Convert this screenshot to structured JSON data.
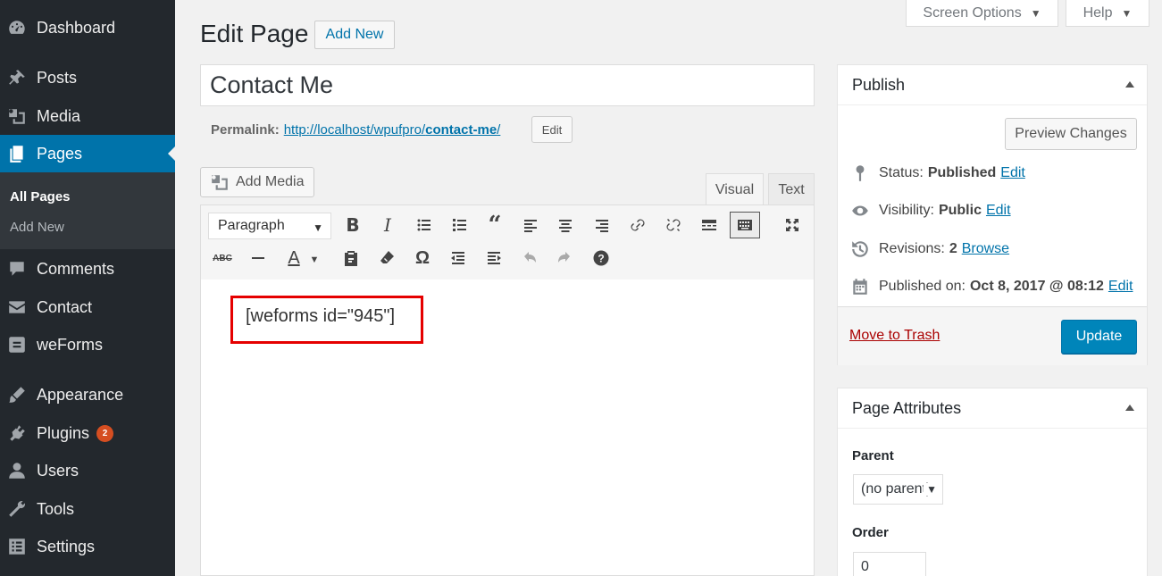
{
  "sidebar": {
    "items": [
      {
        "label": "Dashboard",
        "icon": "dashboard-icon"
      },
      {
        "label": "Posts",
        "icon": "pin-icon"
      },
      {
        "label": "Media",
        "icon": "media-icon"
      },
      {
        "label": "Pages",
        "icon": "pages-icon"
      },
      {
        "label": "Comments",
        "icon": "comments-icon"
      },
      {
        "label": "Contact",
        "icon": "envelope-icon"
      },
      {
        "label": "weForms",
        "icon": "weforms-icon"
      },
      {
        "label": "Appearance",
        "icon": "brush-icon"
      },
      {
        "label": "Plugins",
        "icon": "plugin-icon",
        "badge": "2"
      },
      {
        "label": "Users",
        "icon": "users-icon"
      },
      {
        "label": "Tools",
        "icon": "wrench-icon"
      },
      {
        "label": "Settings",
        "icon": "settings-icon"
      }
    ],
    "submenu": [
      "All Pages",
      "Add New"
    ]
  },
  "screen_meta": {
    "screen_options": "Screen Options",
    "help": "Help"
  },
  "heading": {
    "title": "Edit Page",
    "add_new": "Add New"
  },
  "post": {
    "title": "Contact Me",
    "permalink_label": "Permalink:",
    "permalink_base": "http://localhost/wpufpro/",
    "permalink_slug": "contact-me",
    "permalink_trailing": "/",
    "permalink_edit": "Edit"
  },
  "editor": {
    "add_media": "Add Media",
    "tab_visual": "Visual",
    "tab_text": "Text",
    "format": "Paragraph",
    "content": "[weforms id=\"945\"]",
    "highlight_color": "#e50000"
  },
  "publish": {
    "title": "Publish",
    "preview": "Preview Changes",
    "status_label": "Status:",
    "status_value": "Published",
    "visibility_label": "Visibility:",
    "visibility_value": "Public",
    "revisions_label": "Revisions:",
    "revisions_value": "2",
    "browse": "Browse",
    "published_label": "Published on:",
    "published_value": "Oct 8, 2017 @ 08:12",
    "edit": "Edit",
    "trash": "Move to Trash",
    "update": "Update"
  },
  "attributes": {
    "title": "Page Attributes",
    "parent_label": "Parent",
    "parent_value": "(no parent)",
    "order_label": "Order",
    "order_value": "0"
  },
  "colors": {
    "sidebar": "#23282d",
    "accent": "#0073aa",
    "primary_button": "#0085ba",
    "badge": "#d54e21"
  }
}
